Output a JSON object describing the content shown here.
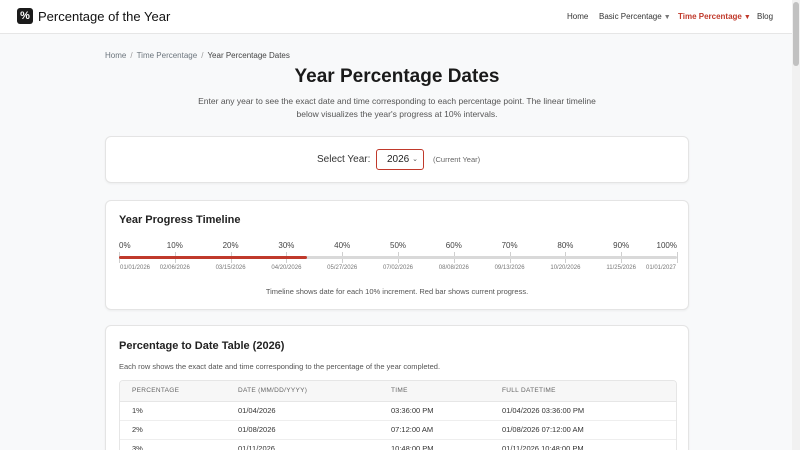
{
  "header": {
    "brand_icon": "%",
    "brand": "Percentage of the Year",
    "nav": [
      {
        "label": "Home",
        "dropdown": false,
        "active": false
      },
      {
        "label": "Basic Percentage",
        "dropdown": true,
        "active": false
      },
      {
        "label": "Time Percentage",
        "dropdown": true,
        "active": true
      },
      {
        "label": "Blog",
        "dropdown": false,
        "active": false
      }
    ],
    "caret": "▼",
    "accent_color": "#c0392b"
  },
  "breadcrumb": {
    "home": "Home",
    "section": "Time Percentage",
    "current": "Year Percentage Dates",
    "separator": "/"
  },
  "page": {
    "title": "Year Percentage Dates",
    "description": "Enter any year to see the exact date and time corresponding to each percentage point. The linear timeline below visualizes the year's progress at 10% intervals."
  },
  "year_selector": {
    "label": "Select Year:",
    "value": "2026",
    "chevron": "⌄",
    "note": "(Current Year)"
  },
  "timeline": {
    "title": "Year Progress Timeline",
    "percent_labels": [
      "0%",
      "10%",
      "20%",
      "30%",
      "40%",
      "50%",
      "60%",
      "70%",
      "80%",
      "90%",
      "100%"
    ],
    "date_labels": [
      "01/01/2026",
      "02/06/2026",
      "03/15/2026",
      "04/20/2026",
      "05/27/2026",
      "07/02/2026",
      "08/08/2026",
      "09/13/2026",
      "10/20/2026",
      "11/25/2026",
      "01/01/2027"
    ],
    "current_progress": 0.337,
    "note": "Timeline shows date for each 10% increment. Red bar shows current progress."
  },
  "table": {
    "title": "Percentage to Date Table (2026)",
    "description": "Each row shows the exact date and time corresponding to the percentage of the year completed.",
    "headers": [
      "PERCENTAGE",
      "DATE (MM/DD/YYYY)",
      "TIME",
      "FULL DATETIME"
    ],
    "rows": [
      [
        "1%",
        "01/04/2026",
        "03:36:00 PM",
        "01/04/2026 03:36:00 PM"
      ],
      [
        "2%",
        "01/08/2026",
        "07:12:00 AM",
        "01/08/2026 07:12:00 AM"
      ],
      [
        "3%",
        "01/11/2026",
        "10:48:00 PM",
        "01/11/2026 10:48:00 PM"
      ]
    ]
  }
}
